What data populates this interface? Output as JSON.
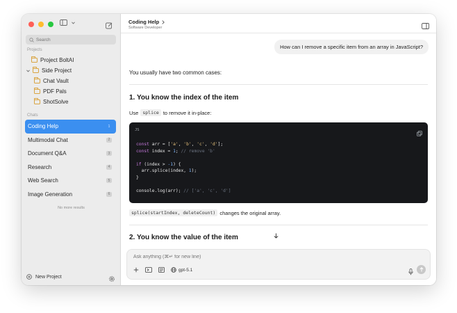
{
  "sidebar": {
    "search_placeholder": "Search",
    "projects_label": "Projects",
    "projects": [
      {
        "label": "Project BoltAI"
      },
      {
        "label": "Side Project"
      },
      {
        "label": "Chat Vault"
      },
      {
        "label": "PDF Pals"
      },
      {
        "label": "ShotSolve"
      }
    ],
    "chats_label": "Chats",
    "chats": [
      {
        "label": "Coding Help",
        "badge": "1"
      },
      {
        "label": "Multimodal Chat",
        "badge": "2"
      },
      {
        "label": "Document Q&A",
        "badge": "3"
      },
      {
        "label": "Research",
        "badge": "4"
      },
      {
        "label": "Web Search",
        "badge": "5"
      },
      {
        "label": "Image Generation",
        "badge": "6"
      }
    ],
    "no_more": "No more results",
    "new_project": "New Project"
  },
  "header": {
    "title": "Coding Help",
    "subtitle": "Software Developer"
  },
  "conversation": {
    "user_message": "How can I remove a specific item from an array in JavaScript?",
    "intro": "You usually have two common cases:",
    "heading1": "1. You know the index of the item",
    "use_prefix": "Use",
    "use_code": "splice",
    "use_suffix": "to remove it in-place:",
    "code_lang": "JS",
    "note_code": "splice(startIndex, deleteCount)",
    "note_suffix": "changes the original array.",
    "heading2": "2. You know the value of the item"
  },
  "composer": {
    "placeholder": "Ask anything (⌘↵ for new line)",
    "model": "gpt-5.1"
  }
}
